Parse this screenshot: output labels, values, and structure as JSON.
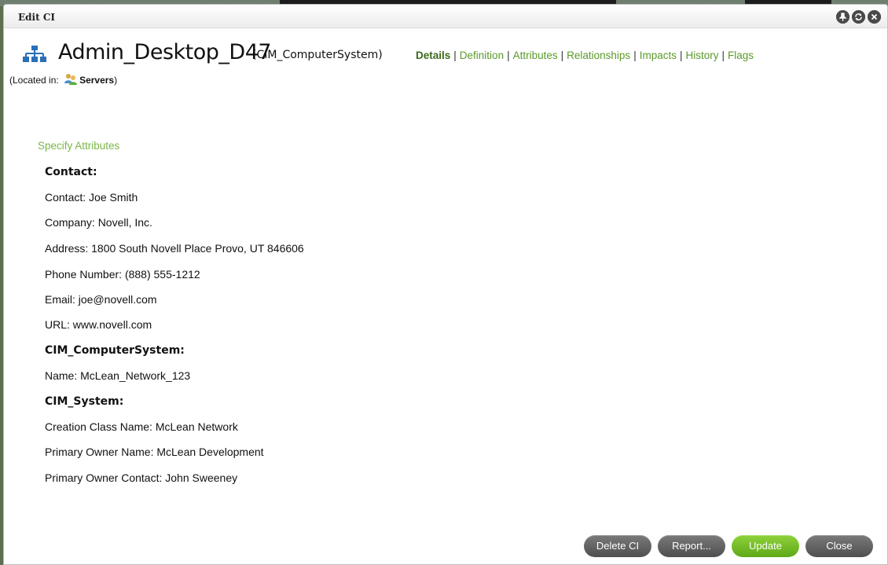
{
  "window": {
    "title": "Edit CI",
    "controls": [
      "pin-icon",
      "refresh-icon",
      "close-icon"
    ]
  },
  "ci": {
    "name": "Admin_Desktop_D47",
    "class": "(CIM_ComputerSystem)",
    "icon": "network-hierarchy-icon",
    "located_prefix": "(Located in:",
    "located_folder": "Servers",
    "located_suffix": ")"
  },
  "nav": {
    "items": [
      {
        "label": "Details",
        "active": true
      },
      {
        "label": "Definition",
        "active": false
      },
      {
        "label": "Attributes",
        "active": false
      },
      {
        "label": "Relationships",
        "active": false
      },
      {
        "label": "Impacts",
        "active": false
      },
      {
        "label": "History",
        "active": false
      },
      {
        "label": "Flags",
        "active": false
      }
    ],
    "separator": "|"
  },
  "section": {
    "link": "Specify Attributes"
  },
  "attributes": {
    "contact_heading": "Contact:",
    "contact": "Contact:  Joe Smith",
    "company": "Company:  Novell, Inc.",
    "address": "Address:  1800 South Novell Place Provo, UT 846606",
    "phone": "Phone Number:  (888) 555-1212",
    "email": "Email:  joe@novell.com",
    "url": "URL:  www.novell.com",
    "computer_heading": "CIM_ComputerSystem:",
    "name": "Name:  McLean_Network_123",
    "system_heading": "CIM_System:",
    "creation_class": "Creation Class Name:  McLean Network",
    "primary_owner_name": "Primary Owner Name:  McLean Development",
    "primary_owner_contact": "Primary Owner Contact:  John Sweeney"
  },
  "buttons": {
    "delete": "Delete CI",
    "report": "Report...",
    "update": "Update",
    "close": "Close"
  },
  "colors": {
    "accent_green": "#5a9a2a",
    "button_green": "#6cb523",
    "button_gray": "#5c5c5c"
  }
}
